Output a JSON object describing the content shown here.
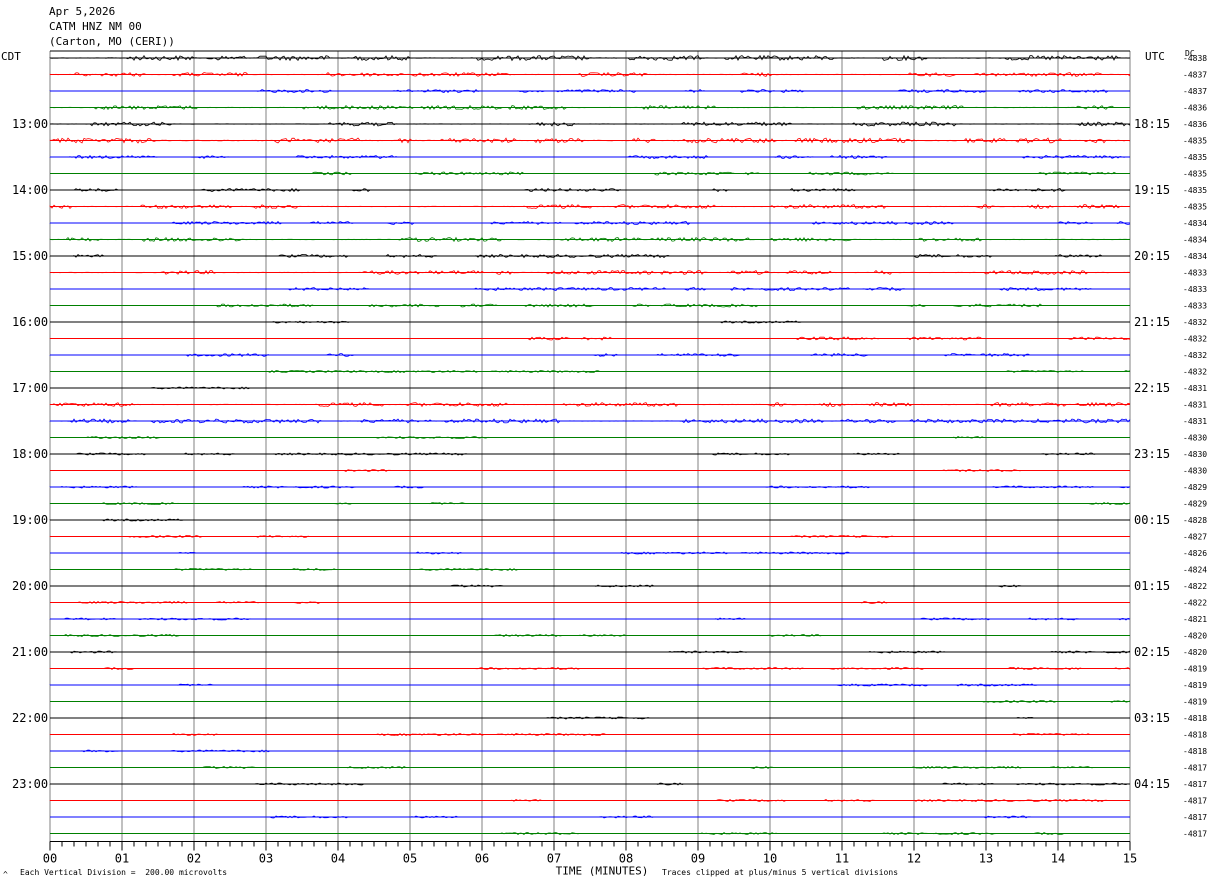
{
  "header": {
    "date": "Apr 5,2026",
    "station": "CATM HNZ NM 00",
    "location": "(Carton, MO (CERI))"
  },
  "corners": {
    "left": "CDT",
    "right": "UTC",
    "dc": "DC"
  },
  "footer": {
    "scale_note": "Each Vertical Division =  200.00 microvolts",
    "clip_note": "Traces clipped at plus/minus 5 vertical divisions",
    "mark": "^"
  },
  "colors": {
    "black": "#000000",
    "red": "#ff0000",
    "blue": "#0000ff",
    "green": "#008000",
    "grid": "#808080"
  },
  "chart_data": {
    "type": "line",
    "title": "",
    "xlabel": "TIME (MINUTES)",
    "ylabel": "",
    "xlim": [
      0,
      15
    ],
    "x_ticks": [
      "00",
      "01",
      "02",
      "03",
      "04",
      "05",
      "06",
      "07",
      "08",
      "09",
      "10",
      "11",
      "12",
      "13",
      "14",
      "15"
    ],
    "trace_colors": [
      "black",
      "red",
      "blue",
      "green"
    ],
    "rows_per_hour": 4,
    "left_labels": [
      "13:00",
      "14:00",
      "15:00",
      "16:00",
      "17:00",
      "18:00",
      "19:00",
      "20:00",
      "21:00",
      "22:00",
      "23:00"
    ],
    "right_labels": [
      "18:15",
      "19:15",
      "20:15",
      "21:15",
      "22:15",
      "23:15",
      "00:15",
      "01:15",
      "02:15",
      "03:15",
      "04:15"
    ],
    "dc_offsets": [
      "-4838",
      "-4837",
      "-4837",
      "-4836",
      "-4836",
      "-4835",
      "-4835",
      "-4835",
      "-4835",
      "-4835",
      "-4834",
      "-4834",
      "-4834",
      "-4833",
      "-4833",
      "-4833",
      "-4832",
      "-4832",
      "-4832",
      "-4832",
      "-4831",
      "-4831",
      "-4831",
      "-4830",
      "-4830",
      "-4830",
      "-4829",
      "-4829",
      "-4828",
      "-4827",
      "-4826",
      "-4824",
      "-4822",
      "-4822",
      "-4821",
      "-4820",
      "-4820",
      "-4819",
      "-4819",
      "-4819",
      "-4818",
      "-4818",
      "-4818",
      "-4817",
      "-4817",
      "-4817",
      "-4817",
      "-4817"
    ],
    "activity": [
      4,
      3,
      2,
      3,
      3,
      4,
      2,
      2,
      2,
      3,
      2,
      3,
      2,
      3,
      2,
      2,
      1,
      2,
      2,
      1,
      1,
      3,
      3,
      1,
      1,
      1,
      1,
      1,
      1,
      1,
      1,
      1,
      1,
      1,
      1,
      1,
      1,
      1,
      1,
      1,
      1,
      1,
      1,
      1,
      1,
      1,
      1,
      1
    ]
  }
}
